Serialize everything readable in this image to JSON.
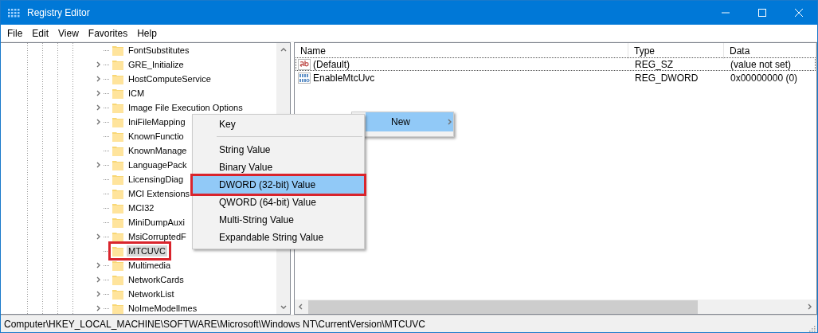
{
  "window": {
    "title": "Registry Editor"
  },
  "menu_bar": [
    "File",
    "Edit",
    "View",
    "Favorites",
    "Help"
  ],
  "tree": {
    "items": [
      {
        "label": "FontSubstitutes",
        "expandable": false,
        "selected": false,
        "highlighted": false
      },
      {
        "label": "GRE_Initialize",
        "expandable": true,
        "selected": false,
        "highlighted": false
      },
      {
        "label": "HostComputeService",
        "expandable": true,
        "selected": false,
        "highlighted": false
      },
      {
        "label": "ICM",
        "expandable": true,
        "selected": false,
        "highlighted": false
      },
      {
        "label": "Image File Execution Options",
        "expandable": true,
        "selected": false,
        "highlighted": false
      },
      {
        "label": "IniFileMapping",
        "expandable": true,
        "selected": false,
        "highlighted": false
      },
      {
        "label": "KnownFunctio",
        "expandable": false,
        "selected": false,
        "highlighted": false
      },
      {
        "label": "KnownManage",
        "expandable": false,
        "selected": false,
        "highlighted": false
      },
      {
        "label": "LanguagePack",
        "expandable": true,
        "selected": false,
        "highlighted": false
      },
      {
        "label": "LicensingDiag",
        "expandable": false,
        "selected": false,
        "highlighted": false
      },
      {
        "label": "MCI Extensions",
        "expandable": false,
        "selected": false,
        "highlighted": false
      },
      {
        "label": "MCI32",
        "expandable": false,
        "selected": false,
        "highlighted": false
      },
      {
        "label": "MiniDumpAuxi",
        "expandable": false,
        "selected": false,
        "highlighted": false
      },
      {
        "label": "MsiCorruptedF",
        "expandable": true,
        "selected": false,
        "highlighted": false
      },
      {
        "label": "MTCUVC",
        "expandable": false,
        "selected": true,
        "highlighted": true
      },
      {
        "label": "Multimedia",
        "expandable": true,
        "selected": false,
        "highlighted": false
      },
      {
        "label": "NetworkCards",
        "expandable": true,
        "selected": false,
        "highlighted": false
      },
      {
        "label": "NetworkList",
        "expandable": true,
        "selected": false,
        "highlighted": false
      },
      {
        "label": "NoImeModelImes",
        "expandable": true,
        "selected": false,
        "highlighted": false
      }
    ]
  },
  "values": {
    "columns": [
      "Name",
      "Type",
      "Data"
    ],
    "rows": [
      {
        "kind": "string",
        "name": "(Default)",
        "type": "REG_SZ",
        "data": "(value not set)",
        "focused": true
      },
      {
        "kind": "binary",
        "name": "EnableMtcUvc",
        "type": "REG_DWORD",
        "data": "0x00000000 (0)",
        "focused": false
      }
    ]
  },
  "context_menu": {
    "items": [
      {
        "label": "New",
        "selected": true
      }
    ]
  },
  "submenu": {
    "items": [
      {
        "kind": "item",
        "label": "Key",
        "selected": false,
        "highlighted": false
      },
      {
        "kind": "separator"
      },
      {
        "kind": "item",
        "label": "String Value",
        "selected": false,
        "highlighted": false
      },
      {
        "kind": "item",
        "label": "Binary Value",
        "selected": false,
        "highlighted": false
      },
      {
        "kind": "item",
        "label": "DWORD (32-bit) Value",
        "selected": true,
        "highlighted": true
      },
      {
        "kind": "item",
        "label": "QWORD (64-bit) Value",
        "selected": false,
        "highlighted": false
      },
      {
        "kind": "item",
        "label": "Multi-String Value",
        "selected": false,
        "highlighted": false
      },
      {
        "kind": "item",
        "label": "Expandable String Value",
        "selected": false,
        "highlighted": false
      }
    ]
  },
  "status_bar": {
    "path": "Computer\\HKEY_LOCAL_MACHINE\\SOFTWARE\\Microsoft\\Windows NT\\CurrentVersion\\MTCUVC"
  }
}
